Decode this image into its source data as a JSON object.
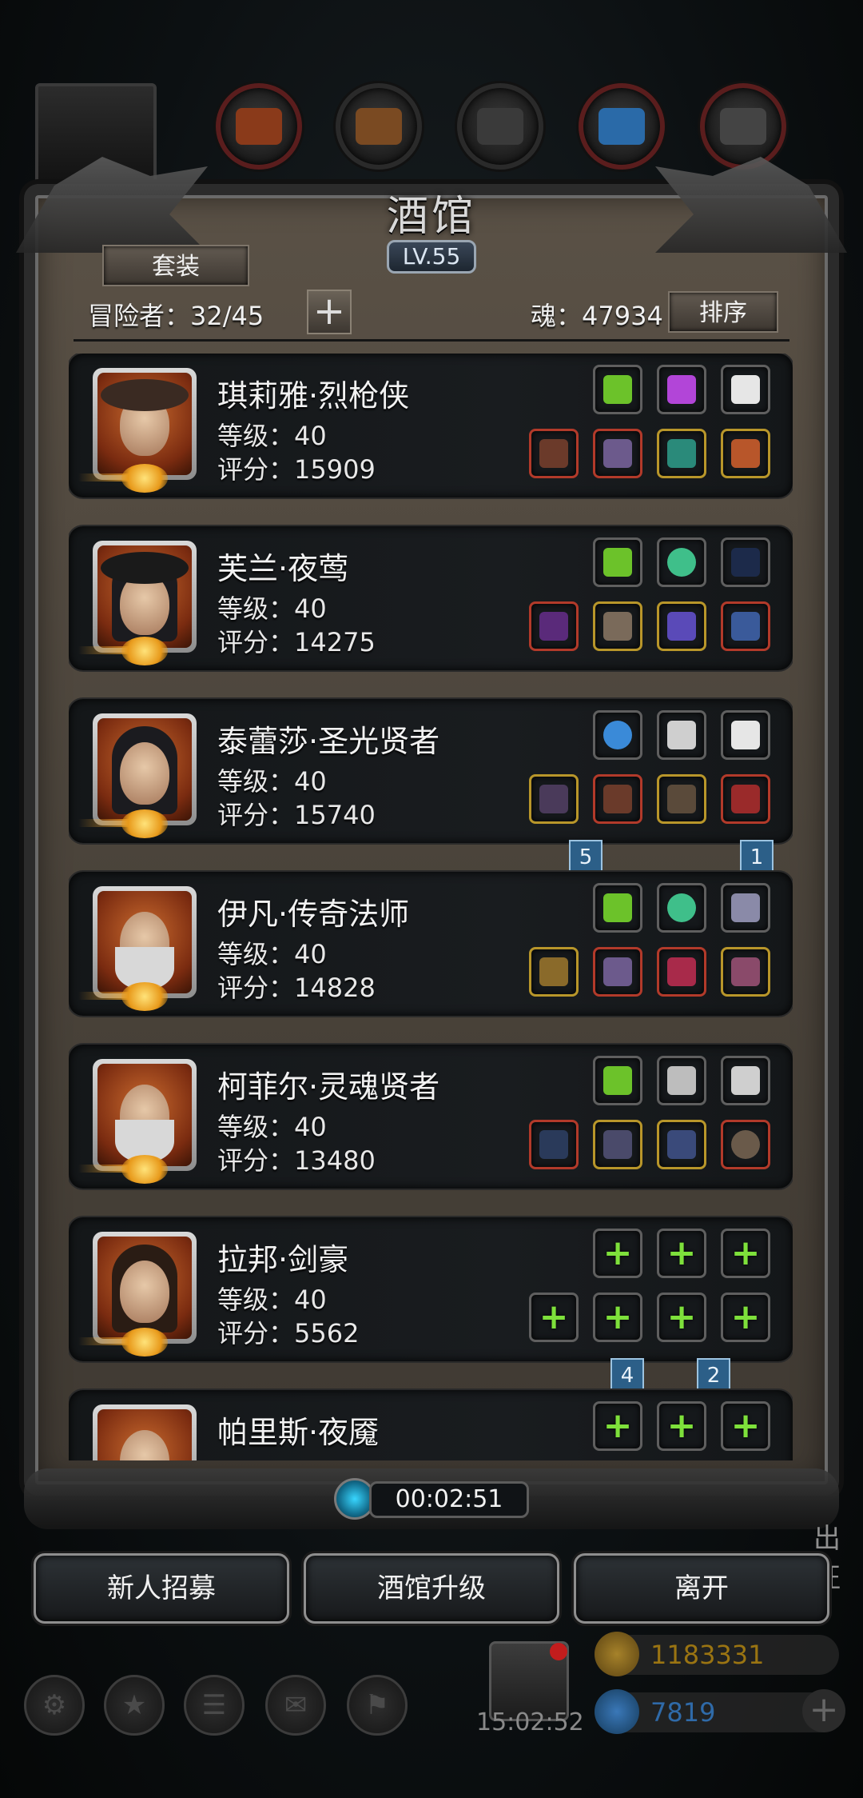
{
  "title": "酒馆",
  "level": "LV.55",
  "set_button": "套装",
  "adventurers_label": "冒险者：32/45",
  "soul_label": "魂：47934",
  "sort_button": "排序",
  "heroes": [
    {
      "name": "琪莉雅·烈枪侠",
      "level": "等级：40",
      "score": "评分：15909"
    },
    {
      "name": "芙兰·夜莺",
      "level": "等级：40",
      "score": "评分：14275"
    },
    {
      "name": "泰蕾莎·圣光贤者",
      "level": "等级：40",
      "score": "评分：15740"
    },
    {
      "name": "伊凡·传奇法师",
      "level": "等级：40",
      "score": "评分：14828"
    },
    {
      "name": "柯菲尔·灵魂贤者",
      "level": "等级：40",
      "score": "评分：13480"
    },
    {
      "name": "拉邦·剑豪",
      "level": "等级：40",
      "score": "评分：5562"
    },
    {
      "name": "帕里斯·夜魇",
      "level": "",
      "score": ""
    }
  ],
  "ribbons": {
    "r1": "5",
    "r2": "1",
    "r3": "4",
    "r4": "2"
  },
  "timer": "00:02:51",
  "buttons": {
    "recruit": "新人招募",
    "upgrade": "酒馆升级",
    "leave": "离开"
  },
  "side_label": "出征",
  "clock": "15:02:52",
  "gold": "1183331",
  "gems": "7819",
  "colors": {
    "gold_text": "#b8860b",
    "gem_text": "#2f6aa8",
    "plus_green": "#7ee03b"
  }
}
